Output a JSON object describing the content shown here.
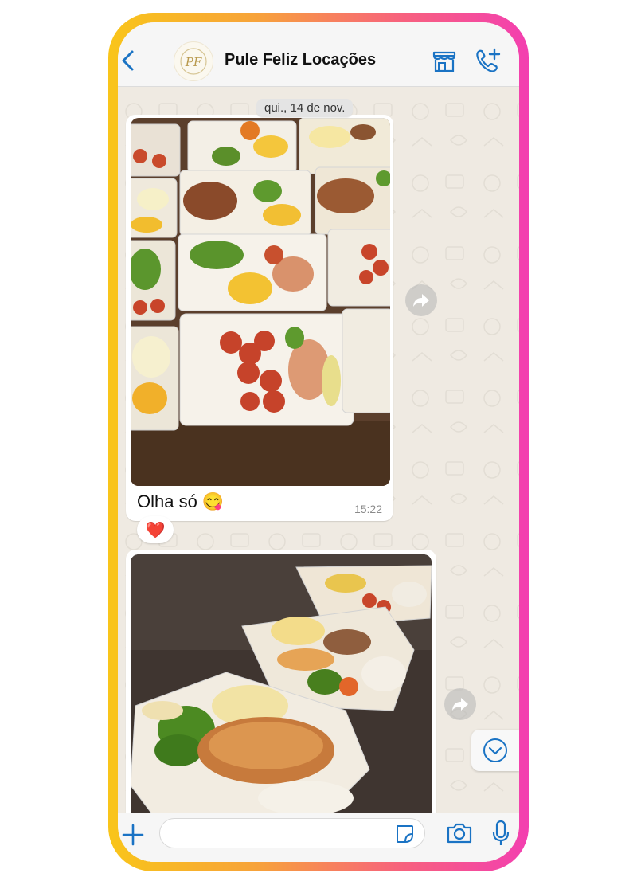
{
  "header": {
    "contact_name": "Pule Feliz Locações",
    "avatar_initials": "PF",
    "icons": [
      "back-chevron-icon",
      "store-icon",
      "call-add-icon"
    ]
  },
  "chat": {
    "date_label": "qui., 14 de nov.",
    "messages": [
      {
        "type": "image",
        "image_desc": "meal-prep containers with rice, sausage, fish, broccoli",
        "caption": "Olha  só 😋",
        "time": "15:22",
        "reaction": "❤️"
      },
      {
        "type": "image",
        "image_desc": "containers with fish fillet, broccoli, rice and puree",
        "caption": "",
        "time": ""
      }
    ]
  },
  "input_bar": {
    "placeholder": "",
    "icons": [
      "plus-icon",
      "sticker-icon",
      "camera-icon",
      "microphone-icon"
    ]
  },
  "colors": {
    "accent": "#1a73c4",
    "chat_bg": "#efeae2",
    "bubble": "#ffffff",
    "frame_gradient": [
      "#f9c51a",
      "#f33fb0"
    ]
  }
}
